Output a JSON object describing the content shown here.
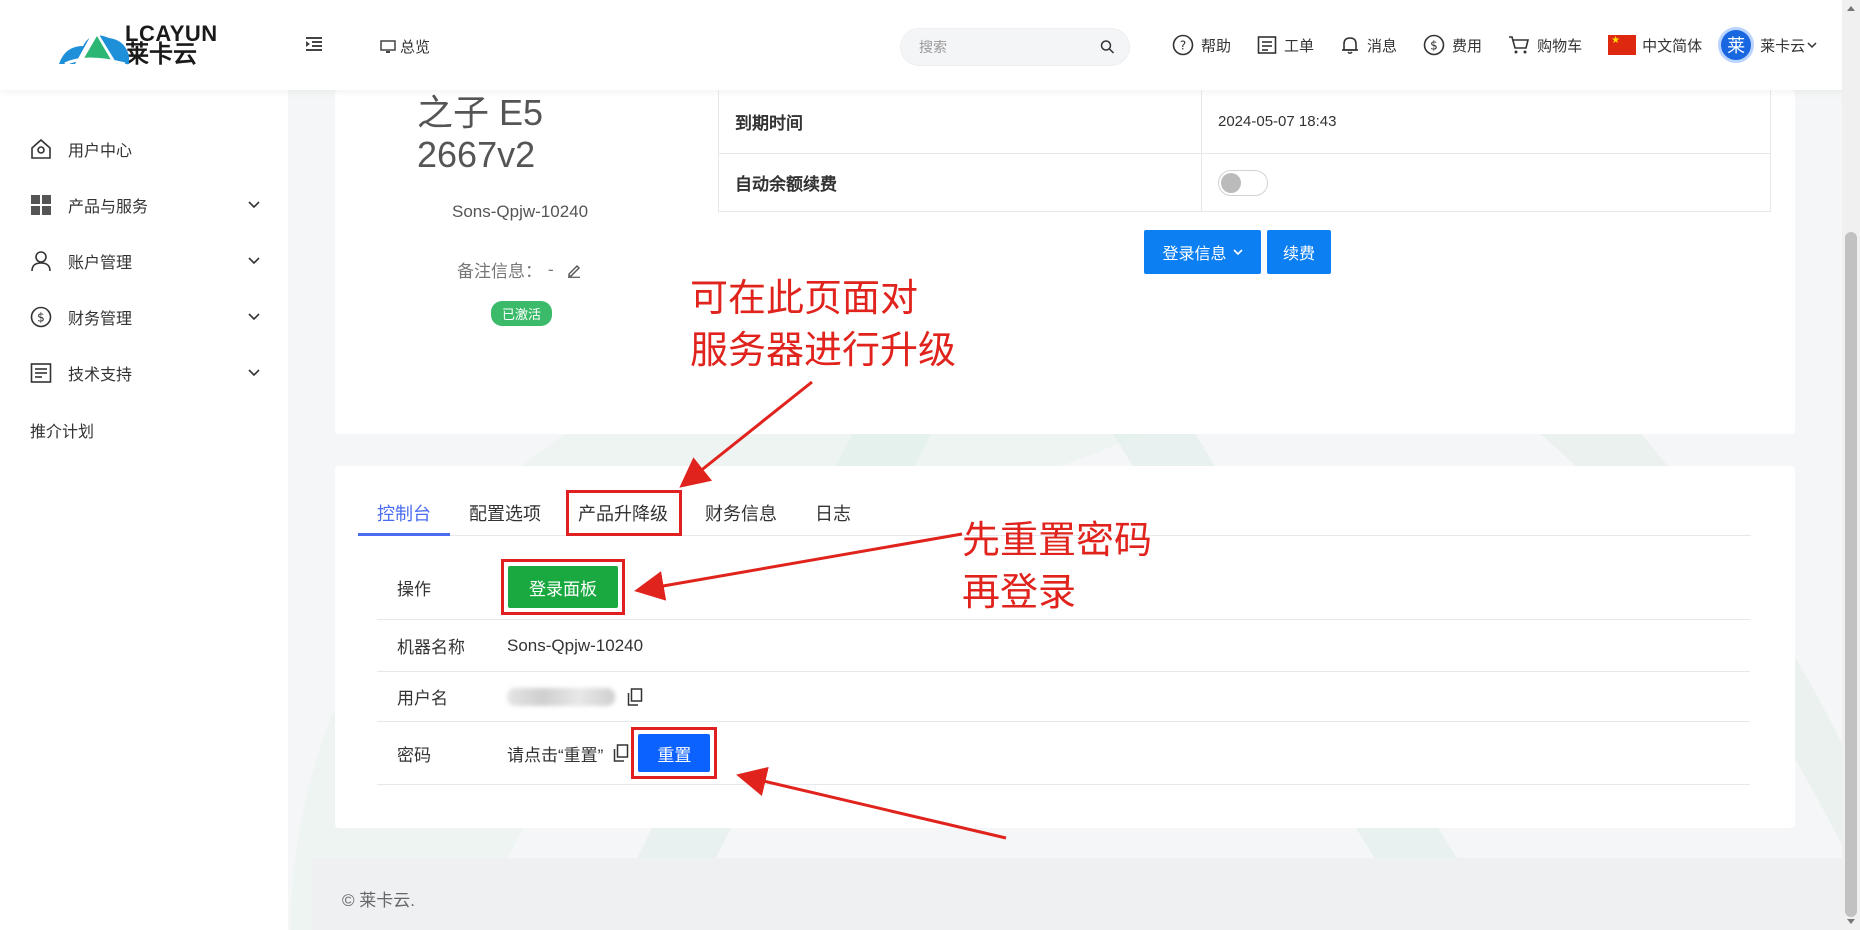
{
  "header": {
    "logo_en": "LCAYUN",
    "logo_cn": "莱卡云",
    "overview_label": "总览",
    "search_placeholder": "搜索",
    "nav": {
      "help": "帮助",
      "ticket": "工单",
      "messages": "消息",
      "fees": "费用",
      "cart": "购物车",
      "language": "中文简体",
      "user_avatar": "莱",
      "user_name": "莱卡云"
    }
  },
  "sidebar": {
    "items": [
      {
        "label": "用户中心",
        "icon": "home-icon"
      },
      {
        "label": "产品与服务",
        "icon": "grid-icon"
      },
      {
        "label": "账户管理",
        "icon": "user-icon"
      },
      {
        "label": "财务管理",
        "icon": "dollar-icon"
      },
      {
        "label": "技术支持",
        "icon": "document-icon"
      }
    ],
    "referral": "推介计划"
  },
  "product": {
    "name_line1": "之子 E5",
    "name_line2": "2667v2",
    "hostname": "Sons-Qpjw-10240",
    "remark_label": "备注信息：",
    "remark_value": "-",
    "status": "已激活",
    "info": [
      {
        "key": "到期时间",
        "value": "2024-05-07 18:43"
      },
      {
        "key": "自动余额续费",
        "value": ""
      }
    ],
    "auto_renew_enabled": false,
    "login_info_button": "登录信息",
    "renew_button": "续费"
  },
  "tabs": [
    "控制台",
    "配置选项",
    "产品升降级",
    "财务信息",
    "日志"
  ],
  "console": {
    "operation_label": "操作",
    "login_panel_button": "登录面板",
    "machine_name_label": "机器名称",
    "machine_name_value": "Sons-Qpjw-10240",
    "username_label": "用户名",
    "password_label": "密码",
    "password_hint": "请点击“重置”",
    "reset_button": "重置"
  },
  "annotations": {
    "upgrade_line1": "可在此页面对",
    "upgrade_line2": "服务器进行升级",
    "reset_line1": "先重置密码",
    "reset_line2": "再登录"
  },
  "footer": {
    "copyright": "© 莱卡云."
  },
  "colors": {
    "primary_blue": "#0c7ff2",
    "tab_active": "#4a6cf0",
    "success_green": "#1aa940",
    "annotation_red": "#e0231c"
  }
}
